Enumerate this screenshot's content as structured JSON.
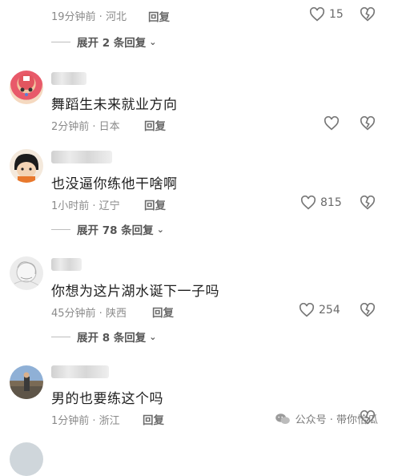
{
  "comments": [
    {
      "meta": "19分钟前 · 河北",
      "reply_label": "回复",
      "likes": "15"
    },
    {
      "text": "舞蹈生未来就业方向",
      "meta": "2分钟前 · 日本",
      "reply_label": "回复",
      "likes": ""
    },
    {
      "text": "也没逼你练他干啥啊",
      "meta": "1小时前 · 辽宁",
      "reply_label": "回复",
      "likes": "815"
    },
    {
      "text": "你想为这片湖水诞下一子吗",
      "meta": "45分钟前 · 陕西",
      "reply_label": "回复",
      "likes": "254"
    },
    {
      "text": "男的也要练这个吗",
      "meta": "1分钟前 · 浙江",
      "reply_label": "回复",
      "likes": ""
    }
  ],
  "expand": [
    {
      "label": "展开 2 条回复"
    },
    {
      "label": "展开 78 条回复"
    },
    {
      "label": "展开 8 条回复"
    }
  ],
  "watermark": {
    "text": "公众号 · 带你恰瓜"
  },
  "icons": {
    "like": "heart-outline-icon",
    "dislike": "broken-heart-icon",
    "chevron": "chevron-down-icon",
    "wechat": "wechat-icon"
  },
  "colors": {
    "meta_text": "#8a8a8a",
    "comment_text": "#1f1f1f"
  }
}
